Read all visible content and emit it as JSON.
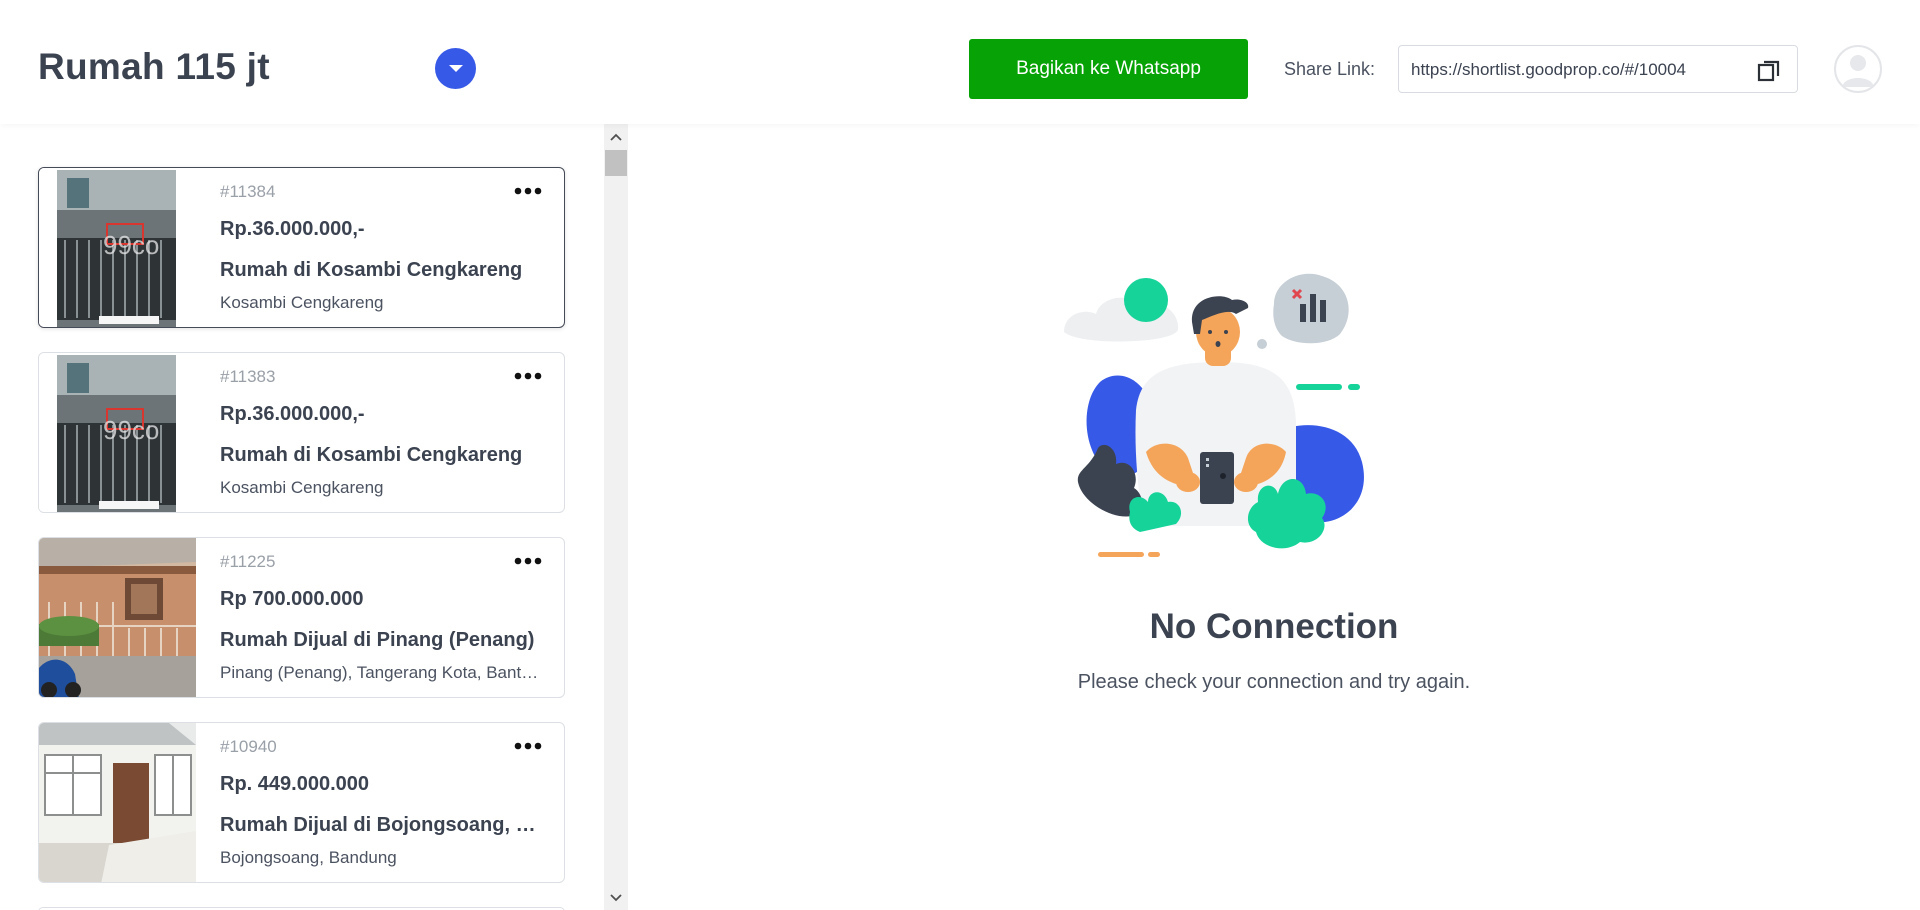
{
  "header": {
    "title": "Rumah 115 jt",
    "whatsapp_button": "Bagikan ke Whatsapp",
    "share_label": "Share Link:",
    "share_url": "https://shortlist.goodprop.co/#/10004"
  },
  "listings": [
    {
      "id": "#11384",
      "price": "Rp.36.000.000,-",
      "name": "Rumah di Kosambi Cengkareng",
      "location": "Kosambi Cengkareng",
      "selected": true,
      "thumb_watermark": "99co"
    },
    {
      "id": "#11383",
      "price": "Rp.36.000.000,-",
      "name": "Rumah di Kosambi Cengkareng",
      "location": "Kosambi Cengkareng",
      "selected": false,
      "thumb_watermark": "99co"
    },
    {
      "id": "#11225",
      "price": "Rp 700.000.000",
      "name": "Rumah Dijual di Pinang (Penang)",
      "location": "Pinang (Penang), Tangerang Kota, Banten",
      "selected": false
    },
    {
      "id": "#10940",
      "price": "Rp. 449.000.000",
      "name": "Rumah Dijual di Bojongsoang, Bandung",
      "location": "Bojongsoang, Bandung",
      "selected": false
    }
  ],
  "empty_state": {
    "title": "No Connection",
    "message": "Please check your connection and try again."
  },
  "colors": {
    "accent": "#3759e8",
    "whatsapp": "#06a206",
    "text": "#3b4250",
    "illustration_green": "#16d39a"
  },
  "icons": {
    "dropdown": "chevron-down-icon",
    "copy": "copy-icon",
    "avatar": "user-icon",
    "more": "more-horizontal-icon"
  }
}
